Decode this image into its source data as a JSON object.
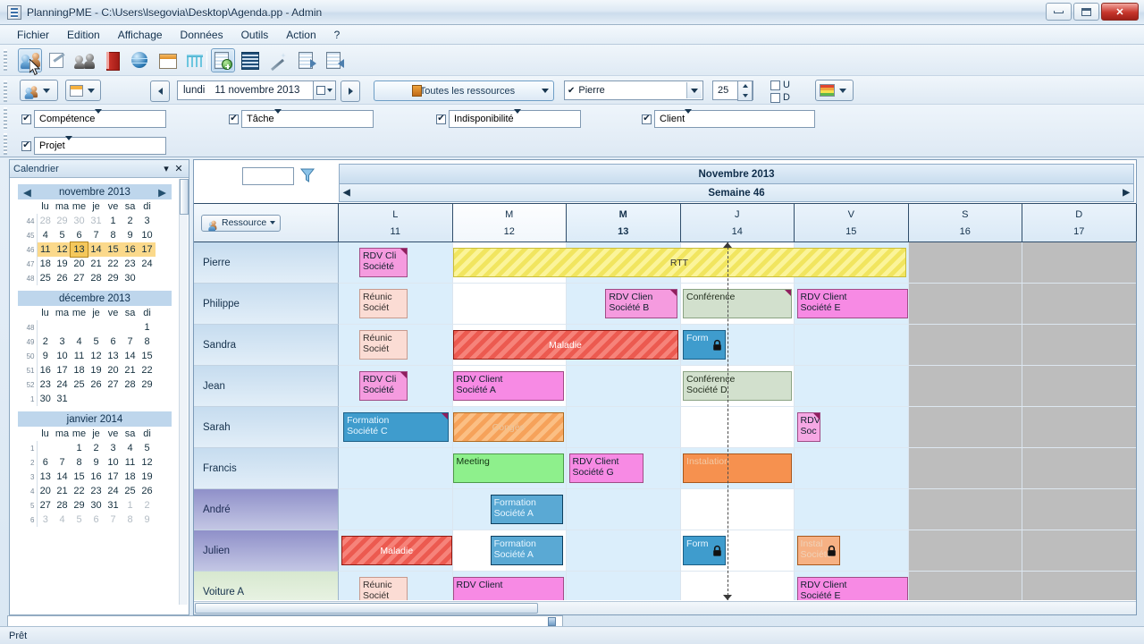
{
  "window": {
    "title": "PlanningPME - C:\\Users\\lsegovia\\Desktop\\Agenda.pp - Admin",
    "minimize_label": "",
    "maximize_label": "",
    "close_label": "✕"
  },
  "menu": {
    "items": [
      "Fichier",
      "Edition",
      "Affichage",
      "Données",
      "Outils",
      "Action",
      "?"
    ]
  },
  "toolbar": {
    "icons": [
      "people-icon",
      "edit-plan-icon",
      "group-icon",
      "red-book-icon",
      "globe-icon",
      "window-icon",
      "rake-icon",
      "add-sheet-icon",
      "grid-report-icon",
      "wand-icon",
      "sheet-forward-icon",
      "sheet-back-icon"
    ],
    "resource_dropdown": "resource-dropdown",
    "view_dropdown": "view-dropdown",
    "prev_label": "◀",
    "next_label": "▶",
    "date_weekday": "lundi",
    "date_value": "11 novembre 2013",
    "resource_filter": "Toutes les ressources",
    "person_filter": "Pierre",
    "zoom_value": "25",
    "check_u": "U",
    "check_d": "D",
    "color_dropdown": "color-legend-dropdown"
  },
  "filters": [
    {
      "label": "Compétence",
      "checked": "✔"
    },
    {
      "label": "Tâche",
      "checked": "✔"
    },
    {
      "label": "Indisponibilité",
      "checked": "✔"
    },
    {
      "label": "Client",
      "checked": "✔"
    },
    {
      "label": "Projet",
      "checked": "✔"
    }
  ],
  "calendar_panel": {
    "title": "Calendrier",
    "collapse_label": "▾",
    "close_label": "✕",
    "weekday_headers": [
      "lu",
      "ma",
      "me",
      "je",
      "ve",
      "sa",
      "di"
    ],
    "months": [
      {
        "name": "novembre 2013",
        "prev": "◀",
        "next": "▶",
        "weeks": [
          {
            "num": "44",
            "highlight": false,
            "days": [
              {
                "d": "28",
                "dim": true
              },
              {
                "d": "29",
                "dim": true
              },
              {
                "d": "30",
                "dim": true
              },
              {
                "d": "31",
                "dim": true
              },
              {
                "d": "1"
              },
              {
                "d": "2"
              },
              {
                "d": "3"
              }
            ]
          },
          {
            "num": "45",
            "highlight": false,
            "days": [
              {
                "d": "4"
              },
              {
                "d": "5"
              },
              {
                "d": "6"
              },
              {
                "d": "7"
              },
              {
                "d": "8"
              },
              {
                "d": "9"
              },
              {
                "d": "10"
              }
            ]
          },
          {
            "num": "46",
            "highlight": true,
            "days": [
              {
                "d": "11"
              },
              {
                "d": "12"
              },
              {
                "d": "13",
                "today": true
              },
              {
                "d": "14"
              },
              {
                "d": "15"
              },
              {
                "d": "16"
              },
              {
                "d": "17"
              }
            ]
          },
          {
            "num": "47",
            "highlight": false,
            "days": [
              {
                "d": "18"
              },
              {
                "d": "19"
              },
              {
                "d": "20"
              },
              {
                "d": "21"
              },
              {
                "d": "22"
              },
              {
                "d": "23"
              },
              {
                "d": "24"
              }
            ]
          },
          {
            "num": "48",
            "highlight": false,
            "days": [
              {
                "d": "25"
              },
              {
                "d": "26"
              },
              {
                "d": "27"
              },
              {
                "d": "28"
              },
              {
                "d": "29"
              },
              {
                "d": "30"
              },
              {
                "d": ""
              }
            ]
          }
        ]
      },
      {
        "name": "décembre 2013",
        "prev": "",
        "next": "",
        "weeks": [
          {
            "num": "48",
            "highlight": false,
            "days": [
              {
                "d": ""
              },
              {
                "d": ""
              },
              {
                "d": ""
              },
              {
                "d": ""
              },
              {
                "d": ""
              },
              {
                "d": ""
              },
              {
                "d": "1"
              }
            ]
          },
          {
            "num": "49",
            "highlight": false,
            "days": [
              {
                "d": "2"
              },
              {
                "d": "3"
              },
              {
                "d": "4"
              },
              {
                "d": "5"
              },
              {
                "d": "6"
              },
              {
                "d": "7"
              },
              {
                "d": "8"
              }
            ]
          },
          {
            "num": "50",
            "highlight": false,
            "days": [
              {
                "d": "9"
              },
              {
                "d": "10"
              },
              {
                "d": "11"
              },
              {
                "d": "12"
              },
              {
                "d": "13"
              },
              {
                "d": "14"
              },
              {
                "d": "15"
              }
            ]
          },
          {
            "num": "51",
            "highlight": false,
            "days": [
              {
                "d": "16"
              },
              {
                "d": "17"
              },
              {
                "d": "18"
              },
              {
                "d": "19"
              },
              {
                "d": "20"
              },
              {
                "d": "21"
              },
              {
                "d": "22"
              }
            ]
          },
          {
            "num": "52",
            "highlight": false,
            "days": [
              {
                "d": "23"
              },
              {
                "d": "24"
              },
              {
                "d": "25"
              },
              {
                "d": "26"
              },
              {
                "d": "27"
              },
              {
                "d": "28"
              },
              {
                "d": "29"
              }
            ]
          },
          {
            "num": "1",
            "highlight": false,
            "days": [
              {
                "d": "30"
              },
              {
                "d": "31"
              },
              {
                "d": ""
              },
              {
                "d": ""
              },
              {
                "d": ""
              },
              {
                "d": ""
              },
              {
                "d": ""
              }
            ]
          }
        ]
      },
      {
        "name": "janvier 2014",
        "prev": "",
        "next": "",
        "weeks": [
          {
            "num": "1",
            "highlight": false,
            "days": [
              {
                "d": ""
              },
              {
                "d": ""
              },
              {
                "d": "1"
              },
              {
                "d": "2"
              },
              {
                "d": "3"
              },
              {
                "d": "4"
              },
              {
                "d": "5"
              }
            ]
          },
          {
            "num": "2",
            "highlight": false,
            "days": [
              {
                "d": "6"
              },
              {
                "d": "7"
              },
              {
                "d": "8"
              },
              {
                "d": "9"
              },
              {
                "d": "10"
              },
              {
                "d": "11"
              },
              {
                "d": "12"
              }
            ]
          },
          {
            "num": "3",
            "highlight": false,
            "days": [
              {
                "d": "13"
              },
              {
                "d": "14"
              },
              {
                "d": "15"
              },
              {
                "d": "16"
              },
              {
                "d": "17"
              },
              {
                "d": "18"
              },
              {
                "d": "19"
              }
            ]
          },
          {
            "num": "4",
            "highlight": false,
            "days": [
              {
                "d": "20"
              },
              {
                "d": "21"
              },
              {
                "d": "22"
              },
              {
                "d": "23"
              },
              {
                "d": "24"
              },
              {
                "d": "25"
              },
              {
                "d": "26"
              }
            ]
          },
          {
            "num": "5",
            "highlight": false,
            "days": [
              {
                "d": "27"
              },
              {
                "d": "28"
              },
              {
                "d": "29"
              },
              {
                "d": "30"
              },
              {
                "d": "31"
              },
              {
                "d": "1",
                "dim": true
              },
              {
                "d": "2",
                "dim": true
              }
            ]
          },
          {
            "num": "6",
            "highlight": false,
            "days": [
              {
                "d": "3",
                "dim": true
              },
              {
                "d": "4",
                "dim": true
              },
              {
                "d": "5",
                "dim": true
              },
              {
                "d": "6",
                "dim": true
              },
              {
                "d": "7",
                "dim": true
              },
              {
                "d": "8",
                "dim": true
              },
              {
                "d": "9",
                "dim": true
              }
            ]
          }
        ]
      }
    ]
  },
  "schedule": {
    "search_value": "",
    "filter_icon": "funnel-icon",
    "month_title": "Novembre 2013",
    "week_title": "Semaine 46",
    "week_prev": "◀",
    "week_next": "▶",
    "resource_button": "Ressource",
    "days": [
      {
        "letter": "L",
        "num": "11",
        "weekend": false,
        "current": false,
        "selected": false
      },
      {
        "letter": "M",
        "num": "12",
        "weekend": false,
        "current": false,
        "selected": true
      },
      {
        "letter": "M",
        "num": "13",
        "weekend": false,
        "current": true,
        "selected": false
      },
      {
        "letter": "J",
        "num": "14",
        "weekend": false,
        "current": false,
        "selected": false
      },
      {
        "letter": "V",
        "num": "15",
        "weekend": false,
        "current": false,
        "selected": false
      },
      {
        "letter": "S",
        "num": "16",
        "weekend": true,
        "current": false,
        "selected": false
      },
      {
        "letter": "D",
        "num": "17",
        "weekend": true,
        "current": false,
        "selected": false
      }
    ],
    "resources": [
      {
        "name": "Pierre",
        "style": "b"
      },
      {
        "name": "Philippe",
        "style": "b"
      },
      {
        "name": "Sandra",
        "style": "b"
      },
      {
        "name": "Jean",
        "style": "b"
      },
      {
        "name": "Sarah",
        "style": "b"
      },
      {
        "name": "Francis",
        "style": "b"
      },
      {
        "name": "André",
        "style": "p"
      },
      {
        "name": "Julien",
        "style": "p"
      },
      {
        "name": "Voiture A",
        "style": "g"
      }
    ],
    "events": [
      {
        "row": 0,
        "col": 0,
        "span": 0.45,
        "offset": 0.18,
        "text": "RDV Cli\nSociété",
        "bg": "#f59bdf",
        "border": "#a04c86",
        "color": "#12202e",
        "corner": true
      },
      {
        "row": 0,
        "col": 1,
        "span": 4.0,
        "offset": 0,
        "text": "RTT",
        "bg": "#fbf49a",
        "border": "#c9bd3a",
        "color": "#333",
        "hatch": "#f1e55f",
        "center": true
      },
      {
        "row": 1,
        "col": 0,
        "span": 0.45,
        "offset": 0.18,
        "text": "Réunic\nSociét",
        "bg": "#fbdcd4",
        "border": "#c79a8e",
        "color": "#35302e"
      },
      {
        "row": 1,
        "col": 2,
        "span": 0.66,
        "offset": 0.34,
        "text": "RDV Clien\nSociété B",
        "bg": "#f59bdf",
        "border": "#a04c86",
        "color": "#12202e",
        "corner": true
      },
      {
        "row": 1,
        "col": 3,
        "span": 0.98,
        "offset": 0.02,
        "text": "Conférence",
        "bg": "#d2e0cd",
        "border": "#8aa383",
        "color": "#24301f",
        "corner": true
      },
      {
        "row": 1,
        "col": 4,
        "span": 1.0,
        "offset": 0.02,
        "text": "RDV Client\nSociété E",
        "bg": "#f78ae4",
        "border": "#a04c86",
        "color": "#12202e"
      },
      {
        "row": 2,
        "col": 0,
        "span": 0.45,
        "offset": 0.18,
        "text": "Réunic\nSociét",
        "bg": "#fbdcd4",
        "border": "#c79a8e",
        "color": "#35302e"
      },
      {
        "row": 2,
        "col": 1,
        "span": 2.0,
        "offset": 0,
        "text": "Maladie",
        "bg": "#ec5a50",
        "border": "#8f1a12",
        "color": "#fff",
        "hatch": "#f6837a",
        "center": true
      },
      {
        "row": 2,
        "col": 3,
        "span": 0.4,
        "offset": 0.02,
        "text": "Form",
        "bg": "#3f9ccd",
        "border": "#1c5f86",
        "color": "#e8f6ff",
        "lock": true
      },
      {
        "row": 3,
        "col": 0,
        "span": 0.45,
        "offset": 0.18,
        "text": "RDV Cli\nSociété",
        "bg": "#f59bdf",
        "border": "#a04c86",
        "color": "#12202e",
        "corner": true
      },
      {
        "row": 3,
        "col": 1,
        "span": 1.0,
        "offset": 0,
        "text": "RDV Client\nSociété A",
        "bg": "#f78ae4",
        "border": "#a04c86",
        "color": "#12202e"
      },
      {
        "row": 3,
        "col": 3,
        "span": 0.98,
        "offset": 0.02,
        "text": "Conférence\nSociété D",
        "bg": "#d2e0cd",
        "border": "#8aa383",
        "color": "#24301f"
      },
      {
        "row": 4,
        "col": 0,
        "span": 0.95,
        "offset": 0.04,
        "text": "Formation\nSociété C",
        "bg": "#3f9ccd",
        "border": "#1c5f86",
        "color": "#e8f6ff",
        "corner": true
      },
      {
        "row": 4,
        "col": 1,
        "span": 1.0,
        "offset": 0,
        "text": "Congés",
        "bg": "#f6a25a",
        "border": "#b06a1f",
        "color": "#e8c6a0",
        "hatch": "#fbbf84",
        "center": true
      },
      {
        "row": 4,
        "col": 4,
        "span": 0.23,
        "offset": 0.02,
        "text": "RDV\nSoc",
        "bg": "#f6a8e4",
        "border": "#a04c86",
        "color": "#12202e",
        "corner": true
      },
      {
        "row": 5,
        "col": 1,
        "span": 1.0,
        "offset": 0,
        "text": "Meeting",
        "bg": "#8ef08c",
        "border": "#4d9a4a",
        "color": "#123312"
      },
      {
        "row": 5,
        "col": 2,
        "span": 0.68,
        "offset": 0.02,
        "text": "RDV Client\nSociété G",
        "bg": "#f78ae4",
        "border": "#a04c86",
        "color": "#12202e"
      },
      {
        "row": 5,
        "col": 3,
        "span": 0.98,
        "offset": 0.02,
        "text": "Instalation",
        "bg": "#f6914f",
        "border": "#a9581c",
        "color": "#f4c9a4"
      },
      {
        "row": 6,
        "col": 1,
        "span": 0.66,
        "offset": 0.33,
        "text": "Formation\nSociété A",
        "bg": "#5aa9d4",
        "border": "#0d3f5f",
        "color": "#e8f6ff"
      },
      {
        "row": 7,
        "col": 0,
        "span": 1.0,
        "offset": 0.02,
        "text": "Maladie",
        "bg": "#ec5a50",
        "border": "#8f1a12",
        "color": "#fff",
        "hatch": "#f6837a",
        "center": true
      },
      {
        "row": 7,
        "col": 1,
        "span": 0.66,
        "offset": 0.33,
        "text": "Formation\nSociété A",
        "bg": "#5aa9d4",
        "border": "#0d3f5f",
        "color": "#e8f6ff"
      },
      {
        "row": 7,
        "col": 3,
        "span": 0.4,
        "offset": 0.02,
        "text": "Form",
        "bg": "#3f9ccd",
        "border": "#1c5f86",
        "color": "#e8f6ff",
        "lock": true
      },
      {
        "row": 7,
        "col": 4,
        "span": 0.4,
        "offset": 0.02,
        "text": "Instal\nSociété",
        "bg": "#f6b184",
        "border": "#a9581c",
        "color": "#f0d2b8",
        "lock": true
      },
      {
        "row": 8,
        "col": 0,
        "span": 0.45,
        "offset": 0.18,
        "text": "Réunic\nSociét",
        "bg": "#fbdcd4",
        "border": "#c79a8e",
        "color": "#35302e"
      },
      {
        "row": 8,
        "col": 1,
        "span": 1.0,
        "offset": 0,
        "text": "RDV Client",
        "bg": "#f78ae4",
        "border": "#a04c86",
        "color": "#12202e"
      },
      {
        "row": 8,
        "col": 4,
        "span": 1.0,
        "offset": 0.02,
        "text": "RDV Client\nSociété E",
        "bg": "#f78ae4",
        "border": "#a04c86",
        "color": "#12202e"
      }
    ]
  },
  "status": {
    "text": "Prêt"
  }
}
